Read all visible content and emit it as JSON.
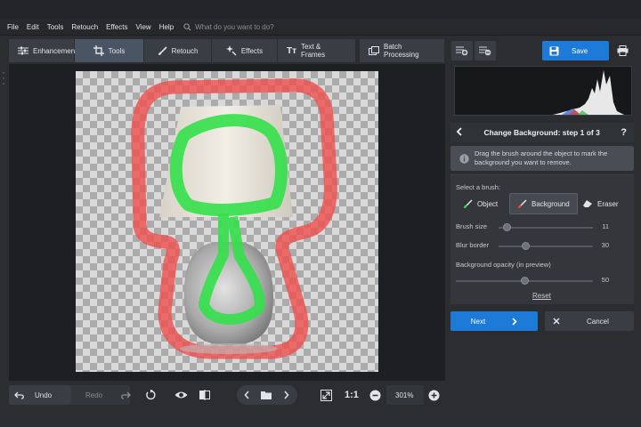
{
  "menu": {
    "items": [
      "File",
      "Edit",
      "Tools",
      "Retouch",
      "Effects",
      "View",
      "Help"
    ],
    "search_placeholder": "What do you want to do?"
  },
  "tabs": [
    {
      "label": "Enhancement",
      "icon": "sliders-icon"
    },
    {
      "label": "Tools",
      "icon": "crop-icon",
      "active": true
    },
    {
      "label": "Retouch",
      "icon": "brush-icon"
    },
    {
      "label": "Effects",
      "icon": "sparkle-icon"
    },
    {
      "label": "Text & Frames",
      "icon": "text-icon"
    },
    {
      "label": "Batch Processing",
      "icon": "batch-icon"
    }
  ],
  "toolbar_right": {
    "save_label": "Save"
  },
  "bottom": {
    "undo_label": "Undo",
    "redo_label": "Redo",
    "ratio_label": "1:1",
    "zoom_value": "301%"
  },
  "panel": {
    "step_title": "Change Background: step 1 of 3",
    "help": "?",
    "info_line1": "Drag the brush around the object to mark the",
    "info_line2": "background you want to remove.",
    "select_brush_label": "Select a brush:",
    "brushes": [
      "Object",
      "Background",
      "Eraser"
    ],
    "brush_size_label": "Brush size",
    "brush_size_value": "11",
    "blur_border_label": "Blur border",
    "blur_border_value": "30",
    "opacity_label": "Background opacity (in preview)",
    "opacity_value": "50",
    "reset_label": "Reset",
    "next_label": "Next",
    "cancel_label": "Cancel"
  },
  "colors": {
    "accent": "#1d7ad6",
    "object_stroke": "#33e04a",
    "background_stroke": "#f04a4a"
  }
}
